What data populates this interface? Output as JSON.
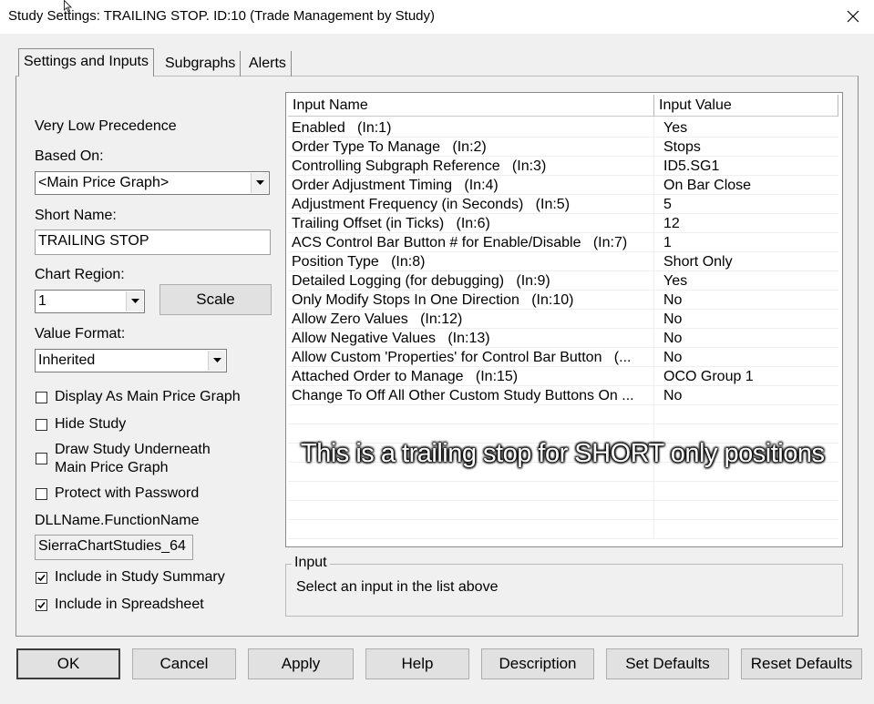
{
  "window": {
    "title": "Study Settings: TRAILING STOP. ID:10 (Trade Management by Study)"
  },
  "tabs": [
    {
      "label": "Settings and Inputs",
      "active": true
    },
    {
      "label": "Subgraphs",
      "active": false
    },
    {
      "label": "Alerts",
      "active": false
    }
  ],
  "left": {
    "precedence": "Very Low Precedence",
    "based_on_label": "Based On:",
    "based_on_value": "<Main Price Graph>",
    "short_name_label": "Short Name:",
    "short_name_value": "TRAILING STOP",
    "chart_region_label": "Chart Region:",
    "chart_region_value": "1",
    "scale_button": "Scale",
    "value_format_label": "Value Format:",
    "value_format_value": "Inherited",
    "checkboxes": [
      {
        "label": "Display As Main Price Graph",
        "checked": false
      },
      {
        "label": "Hide Study",
        "checked": false
      },
      {
        "label": "Draw Study Underneath",
        "label2": "Main Price Graph",
        "checked": false
      },
      {
        "label": "Protect with Password",
        "checked": false
      }
    ],
    "dll_label": "DLLName.FunctionName",
    "dll_value": "SierraChartStudies_64",
    "include_summary": {
      "label": "Include in Study Summary",
      "checked": true
    },
    "include_spreadsheet": {
      "label": "Include in Spreadsheet",
      "checked": true
    }
  },
  "grid": {
    "col_name": "Input Name",
    "col_value": "Input Value",
    "rows": [
      {
        "name": "Enabled   (In:1)",
        "value": "Yes"
      },
      {
        "name": "Order Type To Manage   (In:2)",
        "value": "Stops"
      },
      {
        "name": "Controlling Subgraph Reference   (In:3)",
        "value": "ID5.SG1"
      },
      {
        "name": "Order Adjustment Timing   (In:4)",
        "value": "On Bar Close"
      },
      {
        "name": "Adjustment Frequency (in Seconds)   (In:5)",
        "value": "5"
      },
      {
        "name": "Trailing Offset (in Ticks)   (In:6)",
        "value": "12"
      },
      {
        "name": "ACS Control Bar Button # for Enable/Disable   (In:7)",
        "value": "1"
      },
      {
        "name": "Position Type   (In:8)",
        "value": "Short Only"
      },
      {
        "name": "Detailed Logging (for debugging)   (In:9)",
        "value": "Yes"
      },
      {
        "name": "Only Modify Stops In One Direction   (In:10)",
        "value": "No"
      },
      {
        "name": "Allow Zero Values   (In:12)",
        "value": "No"
      },
      {
        "name": "Allow Negative Values   (In:13)",
        "value": "No"
      },
      {
        "name": "Allow Custom 'Properties' for Control Bar Button   (...",
        "value": "No"
      },
      {
        "name": "Attached Order to Manage   (In:15)",
        "value": "OCO Group 1"
      },
      {
        "name": "Change To Off All Other Custom Study Buttons On ...",
        "value": "No"
      }
    ]
  },
  "overlay": "This is a trailing stop for SHORT only positions",
  "input_group": {
    "title": "Input",
    "text": "Select an input in the list above"
  },
  "buttons": {
    "ok": "OK",
    "cancel": "Cancel",
    "apply": "Apply",
    "help": "Help",
    "description": "Description",
    "set_defaults": "Set Defaults",
    "reset_defaults": "Reset Defaults"
  }
}
